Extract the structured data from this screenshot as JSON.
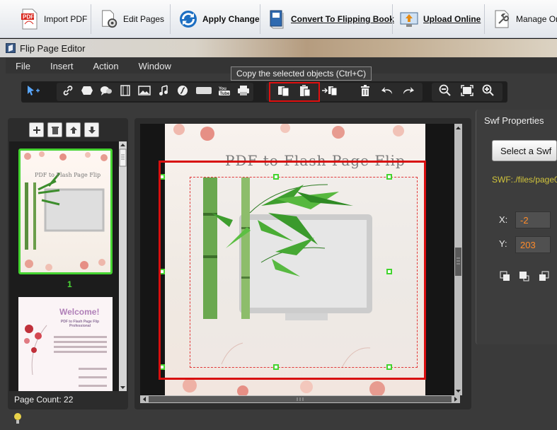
{
  "app_toolbar": {
    "import_pdf": "Import PDF",
    "edit_pages": "Edit Pages",
    "apply_change": "Apply Change",
    "convert": "Convert To Flipping Book",
    "upload": "Upload Online",
    "manage": "Manage Onlin"
  },
  "window": {
    "title": "Flip Page Editor"
  },
  "menu": [
    "File",
    "Insert",
    "Action",
    "Window"
  ],
  "tooltip": "Copy the selected objects (Ctrl+C)",
  "thumbnails": {
    "page_number": "1",
    "page_count_label": "Page Count: 22",
    "page1_title": "PDF to Flash Page Flip",
    "page2_heading": "Welcome!",
    "page2_sub": "PDF to Flash Page Flip Professional"
  },
  "canvas": {
    "page_title": "PDF to Flash Page Flip"
  },
  "properties": {
    "title": "Swf Properties",
    "select_button": "Select a Swf",
    "swf_path": "SWF:./files/page0",
    "x_label": "X:",
    "x_value": "-2",
    "y_label": "Y:",
    "y_value": "203"
  },
  "colors": {
    "selection": "#44d42f",
    "highlight": "#d80f0f",
    "swf_path": "#d2c53c",
    "coord_value": "#ff8c2a"
  }
}
